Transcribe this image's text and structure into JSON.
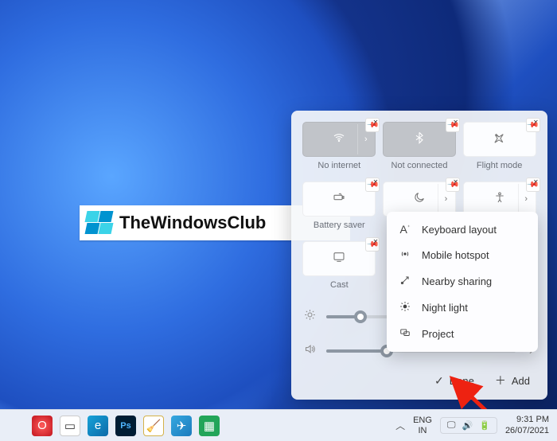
{
  "watermark": {
    "text": "TheWindowsClub"
  },
  "panel": {
    "tiles": {
      "wifi": {
        "label": "No internet"
      },
      "bluetooth": {
        "label": "Not connected"
      },
      "flight": {
        "label": "Flight mode"
      },
      "battery": {
        "label": "Battery saver"
      },
      "focus": {
        "label": "Focus assist"
      },
      "accessibility": {
        "label": "Accessibility"
      },
      "cast": {
        "label": "Cast"
      }
    },
    "sliders": {
      "brightness": {
        "percent": 18
      },
      "volume": {
        "percent": 32
      }
    },
    "footer": {
      "done": "Done",
      "add": "Add"
    }
  },
  "add_menu": {
    "items": [
      {
        "icon": "keyboard-layout-icon",
        "label": "Keyboard layout"
      },
      {
        "icon": "hotspot-icon",
        "label": "Mobile hotspot"
      },
      {
        "icon": "nearby-share-icon",
        "label": "Nearby sharing"
      },
      {
        "icon": "night-light-icon",
        "label": "Night light"
      },
      {
        "icon": "project-icon",
        "label": "Project"
      }
    ]
  },
  "taskbar": {
    "lang1": "ENG",
    "lang2": "IN",
    "time": "9:31 PM",
    "date": "26/07/2021"
  }
}
